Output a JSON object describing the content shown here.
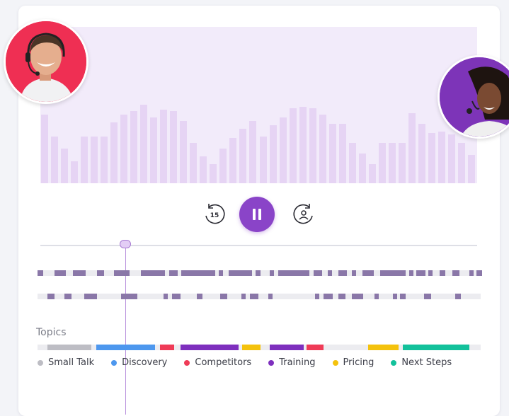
{
  "player": {
    "rewind_label": "15",
    "rewind_icon": "rewind-15-icon",
    "pause_icon": "pause-icon",
    "skip_icon": "skip-speaker-icon",
    "progress_fraction": 0.195
  },
  "waveform": {
    "bar_color": "#e6d4f4",
    "background": "#f2ebfa",
    "amplitudes": [
      0.44,
      0.3,
      0.22,
      0.14,
      0.3,
      0.3,
      0.3,
      0.39,
      0.44,
      0.46,
      0.5,
      0.42,
      0.47,
      0.46,
      0.4,
      0.26,
      0.17,
      0.12,
      0.22,
      0.29,
      0.35,
      0.4,
      0.3,
      0.37,
      0.42,
      0.48,
      0.49,
      0.48,
      0.44,
      0.38,
      0.38,
      0.26,
      0.19,
      0.12,
      0.26,
      0.26,
      0.26,
      0.45,
      0.38,
      0.32,
      0.33,
      0.31,
      0.26,
      0.18
    ]
  },
  "speakers": {
    "left": {
      "name_icon": "speaker-man-avatar",
      "color": "#ef2f53"
    },
    "right": {
      "name_icon": "speaker-woman-avatar",
      "color": "#7d34b8"
    }
  },
  "tracks": {
    "color": "#8a77a8",
    "speaker_1": [
      [
        0,
        8
      ],
      [
        24,
        16
      ],
      [
        50,
        18
      ],
      [
        84,
        10
      ],
      [
        108,
        22
      ],
      [
        146,
        34
      ],
      [
        186,
        12
      ],
      [
        203,
        48
      ],
      [
        256,
        6
      ],
      [
        270,
        33
      ],
      [
        308,
        7
      ],
      [
        328,
        6
      ],
      [
        340,
        44
      ],
      [
        390,
        12
      ],
      [
        410,
        6
      ],
      [
        425,
        12
      ],
      [
        444,
        6
      ],
      [
        459,
        16
      ],
      [
        484,
        36
      ],
      [
        525,
        6
      ],
      [
        535,
        13
      ],
      [
        552,
        6
      ],
      [
        568,
        8
      ],
      [
        586,
        10
      ],
      [
        610,
        6
      ],
      [
        620,
        8
      ]
    ],
    "speaker_2": [
      [
        14,
        10
      ],
      [
        38,
        10
      ],
      [
        66,
        18
      ],
      [
        118,
        10
      ],
      [
        126,
        15
      ],
      [
        178,
        6
      ],
      [
        190,
        12
      ],
      [
        225,
        8
      ],
      [
        258,
        10
      ],
      [
        288,
        6
      ],
      [
        300,
        12
      ],
      [
        326,
        6
      ],
      [
        392,
        6
      ],
      [
        404,
        13
      ],
      [
        425,
        10
      ],
      [
        444,
        16
      ],
      [
        476,
        6
      ],
      [
        502,
        6
      ],
      [
        512,
        8
      ],
      [
        546,
        10
      ],
      [
        590,
        8
      ]
    ]
  },
  "topics": {
    "label": "Topics",
    "segments": [
      {
        "topic": "Small Talk",
        "start": 14,
        "width": 62
      },
      {
        "topic": "Discovery",
        "start": 83,
        "width": 83
      },
      {
        "topic": "Competitors",
        "start": 173,
        "width": 20
      },
      {
        "topic": "Training",
        "start": 202,
        "width": 82
      },
      {
        "topic": "Pricing",
        "start": 289,
        "width": 26
      },
      {
        "topic": "Training",
        "start": 328,
        "width": 48
      },
      {
        "topic": "Competitors",
        "start": 380,
        "width": 24
      },
      {
        "topic": "Pricing",
        "start": 467,
        "width": 43
      },
      {
        "topic": "Next Steps",
        "start": 516,
        "width": 94
      }
    ],
    "legend": [
      {
        "name": "Small Talk",
        "color": "#bdbdc4"
      },
      {
        "name": "Discovery",
        "color": "#4d97ee"
      },
      {
        "name": "Competitors",
        "color": "#ef3b57"
      },
      {
        "name": "Training",
        "color": "#7e2fbe"
      },
      {
        "name": "Pricing",
        "color": "#f4c20d"
      },
      {
        "name": "Next Steps",
        "color": "#13c19b"
      }
    ]
  }
}
